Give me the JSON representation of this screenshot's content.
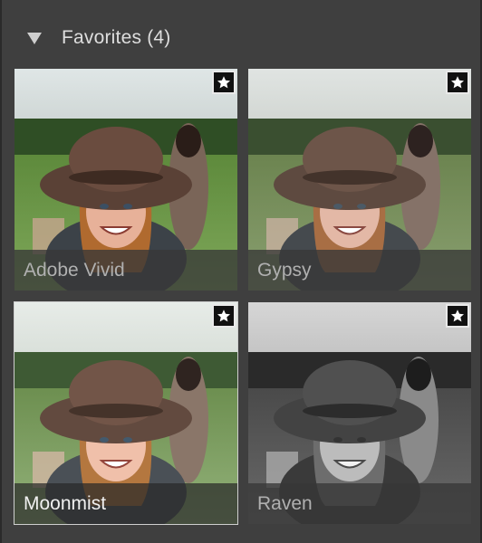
{
  "panel": {
    "section_title": "Favorites (4)",
    "disclosure_icon": "triangle-down-icon"
  },
  "presets": [
    {
      "name": "Adobe Vivid",
      "favorite": true,
      "selected": false,
      "look": "vivid"
    },
    {
      "name": "Gypsy",
      "favorite": true,
      "selected": false,
      "look": "muted"
    },
    {
      "name": "Moonmist",
      "favorite": true,
      "selected": true,
      "look": "soft"
    },
    {
      "name": "Raven",
      "favorite": true,
      "selected": false,
      "look": "mono"
    }
  ],
  "colors": {
    "panel_bg": "#3f3f3f",
    "caption_text": "#b0b0b0",
    "caption_text_selected": "#f0f0f0",
    "badge_bg": "#111111",
    "badge_border": "#e9e9e9"
  }
}
